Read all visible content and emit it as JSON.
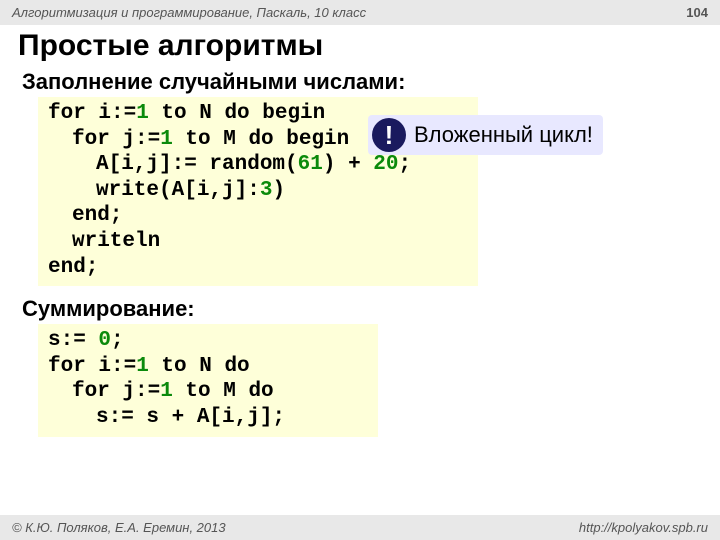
{
  "header": {
    "course": "Алгоритмизация и программирование, Паскаль, 10 класс",
    "page": "104"
  },
  "title": "Простые алгоритмы",
  "section1": {
    "title": "Заполнение случайными числами:",
    "code": {
      "l1a": "for i:=",
      "l1n": "1",
      "l1b": " to N do begin",
      "l2a": "for j:=",
      "l2n": "1",
      "l2b": " to M do begin",
      "l3a": "A[i,j]:= random(",
      "l3n1": "61",
      "l3b": ") + ",
      "l3n2": "20",
      "l3c": ";",
      "l4a": "write(A[i,j]:",
      "l4n": "3",
      "l4b": ")",
      "l5": "end;",
      "l6": "writeln",
      "l7": "end;"
    }
  },
  "callout": {
    "badge": "!",
    "text": "Вложенный цикл!"
  },
  "section2": {
    "title": "Суммирование:",
    "code": {
      "l1a": "s:= ",
      "l1n": "0",
      "l1b": ";",
      "l2a": "for i:=",
      "l2n": "1",
      "l2b": " to N do",
      "l3a": "for j:=",
      "l3n": "1",
      "l3b": " to M do",
      "l4": "s:= s + A[i,j];"
    }
  },
  "footer": {
    "copyright": "© К.Ю. Поляков, Е.А. Еремин, 2013",
    "url": "http://kpolyakov.spb.ru"
  }
}
